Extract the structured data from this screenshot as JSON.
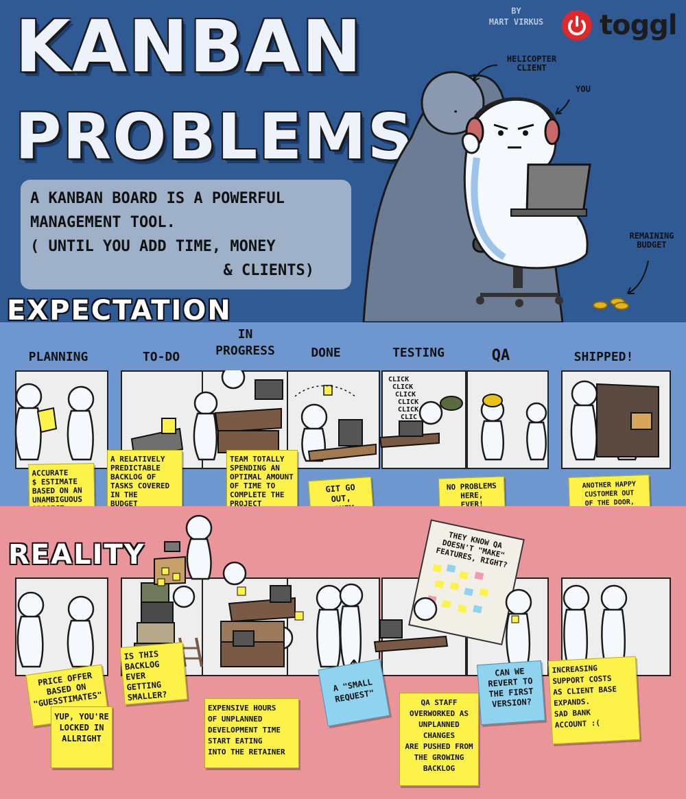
{
  "header": {
    "title_line1": "KANBAN",
    "title_line2": "PROBLEMS",
    "byline": "BY\nMART VIRKUS",
    "brand": "toggl",
    "intro_lines": [
      "A KANBAN BOARD IS A POWERFUL",
      "MANAGEMENT TOOL.",
      "( UNTIL YOU ADD TIME, MONEY",
      "& CLIENTS)"
    ],
    "label_helicopter": "HELICOPTER\nCLIENT",
    "label_you": "YOU",
    "label_budget": "REMAINING\nBUDGET"
  },
  "colors": {
    "header_bg": "#2f5a93",
    "expectation_bg": "#6f97cf",
    "reality_bg": "#e9959a",
    "sticky_yellow": "#fdf24a",
    "sticky_blue": "#8fd3ef",
    "brand_red": "#e0282a"
  },
  "expectation": {
    "label": "EXPECTATION",
    "columns": [
      "PLANNING",
      "TO-DO",
      "IN\nPROGRESS",
      "DONE",
      "TESTING",
      "QA",
      "SHIPPED!"
    ],
    "click_text": [
      "CLICK",
      "CLICK",
      "CLICK",
      "CLICK",
      "CLICK",
      "CLIC"
    ],
    "notes": [
      "ACCURATE\n$ ESTIMATE\nBASED ON AN\nUNAMBIGUOUS\nPROJECT\nVISION",
      "A RELATIVELY\nPREDICTABLE\nBACKLOG OF\nTASKS COVERED\nIN THE\nBUDGET",
      "TEAM TOTALLY\nSPENDING AN\nOPTIMAL AMOUNT\nOF TIME TO\nCOMPLETE THE\nPROJECT",
      "GIT GO\nOUT,\nMONEY\nCOME IN!",
      "NO PROBLEMS\nHERE,\nEVER!",
      "ANOTHER HAPPY\nCUSTOMER OUT\nOF THE DOOR,\nREQUIRING ONLY\nMINIMAL TRAINING\n& ONBOARDING"
    ]
  },
  "reality": {
    "label": "REALITY",
    "qa_sign": "THEY KNOW QA\nDOESN'T \"MAKE\"\nFEATURES, RIGHT?",
    "notes": [
      "PRICE OFFER\nBASED ON\n\"GUESSTIMATES\"",
      "YUP, YOU'RE\nLOCKED IN\nALLRIGHT",
      "IS THIS\nBACKLOG\nEVER GETTING\nSMALLER?",
      "EXPENSIVE HOURS\nOF UNPLANNED\nDEVELOPMENT TIME\nSTART EATING\nINTO THE RETAINER",
      "A \"SMALL\nREQUEST\"",
      "QA STAFF\nOVERWORKED AS\nUNPLANNED CHANGES\nARE PUSHED FROM\nTHE GROWING\nBACKLOG",
      "CAN WE\nREVERT TO\nTHE FIRST\nVERSION?",
      "INCREASING\nSUPPORT COSTS\nAS CLIENT BASE\nEXPANDS.\nSAD BANK\nACCOUNT :("
    ]
  }
}
